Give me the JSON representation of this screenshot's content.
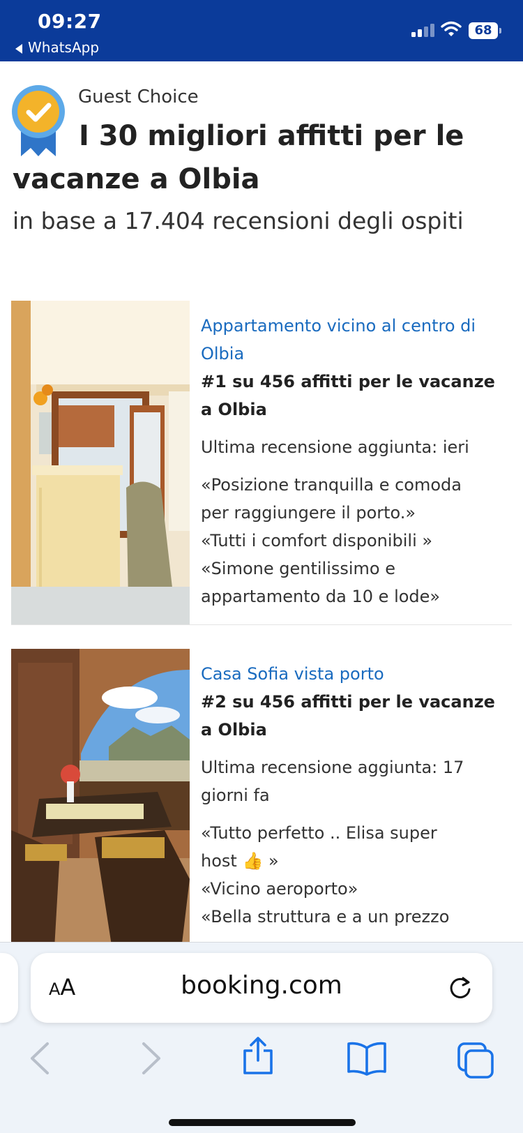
{
  "status_bar": {
    "time": "09:27",
    "back_app": "WhatsApp",
    "battery": "68",
    "icons": [
      "signal-icon",
      "wifi-icon",
      "battery-icon"
    ]
  },
  "header": {
    "badge": "Guest Choice",
    "title": "I 30 migliori affitti per le vacanze a Olbia",
    "subtitle": "in base a 17.404 recensioni degli ospiti"
  },
  "listings": [
    {
      "name_lines": [
        "Appartamento vicino al centro di",
        "Olbia"
      ],
      "rank_lines": [
        "#1 su 456 affitti per le vacanze",
        "a Olbia"
      ],
      "last_review_lines": [
        "Ultima recensione aggiunta: ieri"
      ],
      "review_lines": [
        "«Posizione tranquilla e comoda",
        "per raggiungere il porto.»",
        "«Tutti i comfort disponibili »",
        "«Simone gentilissimo e",
        "appartamento da 10 e lode»"
      ]
    },
    {
      "name_lines": [
        "Casa Sofia vista porto"
      ],
      "rank_lines": [
        "#2 su 456 affitti per le vacanze",
        "a Olbia"
      ],
      "last_review_lines": [
        "Ultima recensione aggiunta: 17",
        "giorni fa"
      ],
      "review_lines": [
        "«Tutto perfetto .. Elisa super",
        "host 👍 »",
        "«Vicino aeroporto»",
        "«Bella struttura e a un prezzo"
      ]
    }
  ],
  "browser": {
    "text_size_label_big": "A",
    "text_size_label_small": "A",
    "url": "booking.com",
    "icons": [
      "reload-icon",
      "back-arrow-icon",
      "forward-arrow-icon",
      "share-icon",
      "bookmarks-icon",
      "tabs-icon"
    ]
  },
  "colors": {
    "status_bar": "#0b3b9a",
    "link": "#1a6bbf",
    "toolbar_icon": "#1a73e8"
  }
}
